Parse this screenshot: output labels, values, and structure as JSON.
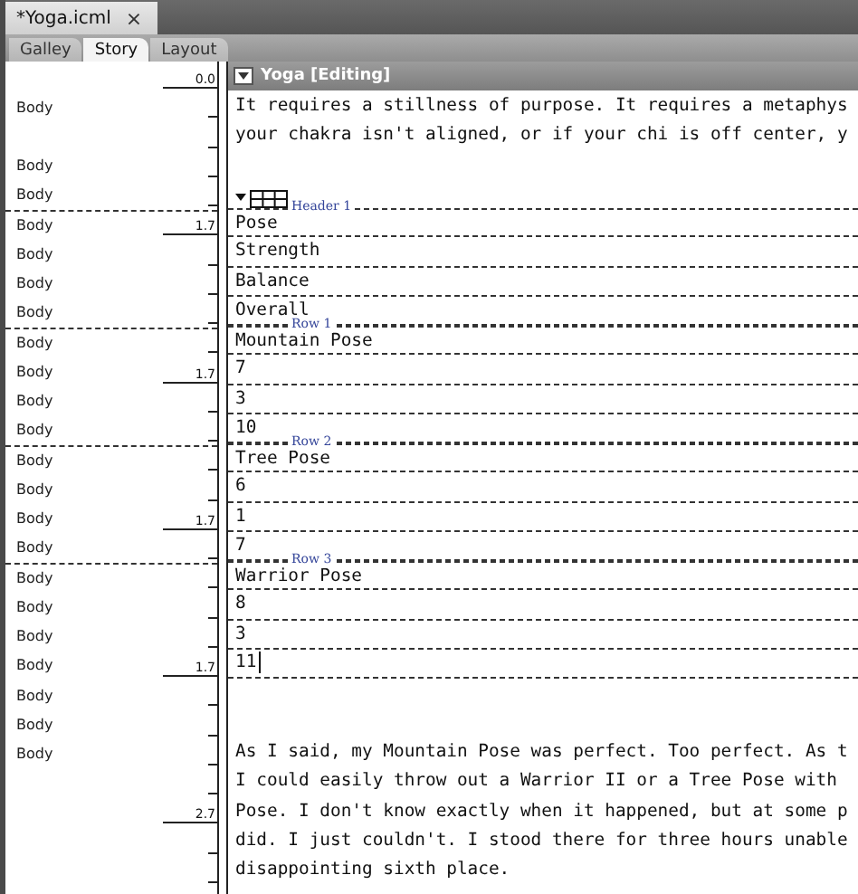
{
  "document_tab": {
    "title": "*Yoga.icml",
    "close": "×"
  },
  "view_tabs": [
    {
      "label": "Galley",
      "selected": false
    },
    {
      "label": "Story",
      "selected": true
    },
    {
      "label": "Layout",
      "selected": false
    }
  ],
  "top_depth": "0.0",
  "story_header": {
    "title": "Yoga [Editing]"
  },
  "lines": [
    {
      "kind": "text",
      "style": "Body",
      "text": "It requires a stillness of purpose. It requires a metaphys"
    },
    {
      "kind": "text",
      "text": "your chakra isn't aligned, or if your chi is off center, y"
    },
    {
      "kind": "blank",
      "style": "Body"
    },
    {
      "kind": "table-start",
      "style": "Body"
    },
    {
      "kind": "cell",
      "style": "Body",
      "depth": "1.7",
      "row_label": "Header 1",
      "text": "Pose"
    },
    {
      "kind": "cell",
      "style": "Body",
      "text": "Strength"
    },
    {
      "kind": "cell",
      "style": "Body",
      "text": "Balance"
    },
    {
      "kind": "cell",
      "style": "Body",
      "text": "Overall"
    },
    {
      "kind": "cell",
      "style": "Body",
      "row_label": "Row 1",
      "text": "Mountain Pose"
    },
    {
      "kind": "cell",
      "style": "Body",
      "depth": "1.7",
      "text": "7"
    },
    {
      "kind": "cell",
      "style": "Body",
      "text": "3"
    },
    {
      "kind": "cell",
      "style": "Body",
      "text": "10"
    },
    {
      "kind": "cell",
      "style": "Body",
      "row_label": "Row 2",
      "text": "Tree Pose"
    },
    {
      "kind": "cell",
      "style": "Body",
      "text": "6"
    },
    {
      "kind": "cell",
      "style": "Body",
      "depth": "1.7",
      "text": "1"
    },
    {
      "kind": "cell",
      "style": "Body",
      "text": "7"
    },
    {
      "kind": "cell",
      "style": "Body",
      "row_label": "Row 3",
      "text": "Warrior Pose"
    },
    {
      "kind": "cell",
      "style": "Body",
      "text": "8"
    },
    {
      "kind": "cell",
      "style": "Body",
      "text": "3"
    },
    {
      "kind": "cell",
      "style": "Body",
      "depth": "1.7",
      "text": "11",
      "cursor": true
    },
    {
      "kind": "blank",
      "style": "Body"
    },
    {
      "kind": "blank",
      "style": "Body"
    },
    {
      "kind": "text",
      "style": "Body",
      "text": "As I said, my Mountain Pose was perfect. Too perfect. As t"
    },
    {
      "kind": "text",
      "text": "I could easily throw out a Warrior II or a Tree Pose with"
    },
    {
      "kind": "text",
      "depth": "2.7",
      "text": "Pose. I don't know exactly when it happened, but at some p"
    },
    {
      "kind": "text",
      "text": "did. I just couldn't. I stood there for three hours unable"
    },
    {
      "kind": "text",
      "text": "disappointing sixth place."
    }
  ]
}
